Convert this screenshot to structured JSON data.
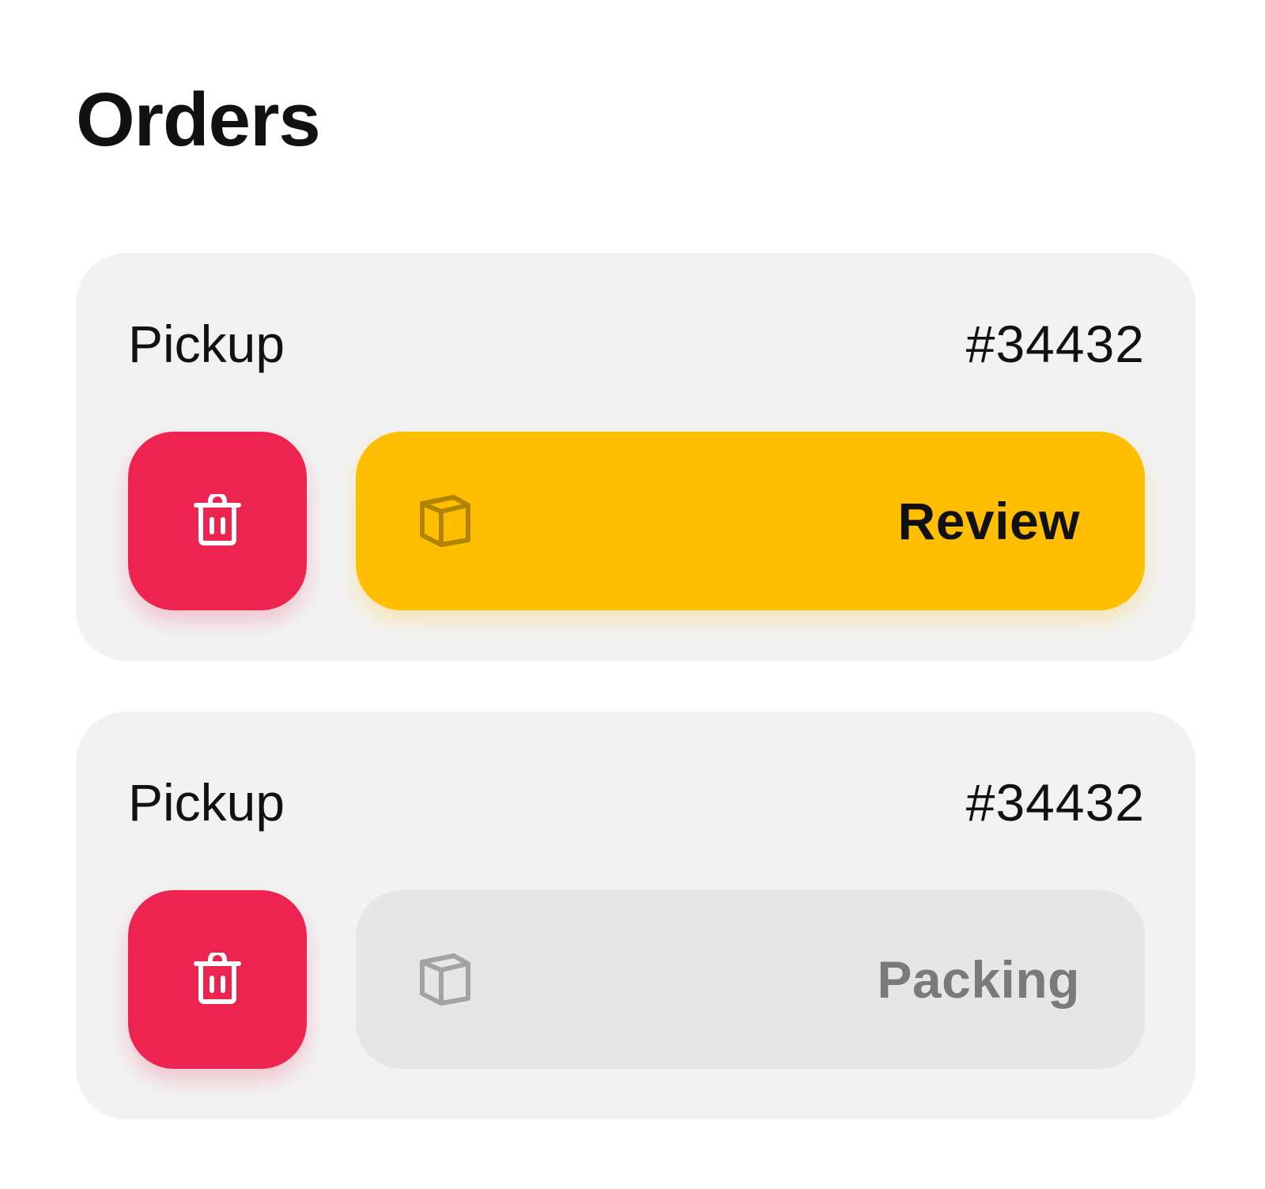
{
  "page": {
    "title": "Orders"
  },
  "orders": [
    {
      "type": "Pickup",
      "number": "#34432",
      "status": "Review",
      "status_bg": "#ffbf00",
      "status_text_color": "#111111",
      "status_icon": "box-icon",
      "status_icon_color": "#b08300",
      "delete_icon": "trash-icon",
      "delete_bg": "#ee2450",
      "active": true
    },
    {
      "type": "Pickup",
      "number": "#34432",
      "status": "Packing",
      "status_bg": "#e6e6e6",
      "status_text_color": "#7a7a7a",
      "status_icon": "box-icon",
      "status_icon_color": "#a3a3a3",
      "delete_icon": "trash-icon",
      "delete_bg": "#ee2450",
      "active": false
    }
  ],
  "colors": {
    "background": "#ffffff",
    "card_bg": "#f2f2f2",
    "text": "#111111",
    "delete_accent": "#ee2450",
    "review_accent": "#ffbf00"
  }
}
